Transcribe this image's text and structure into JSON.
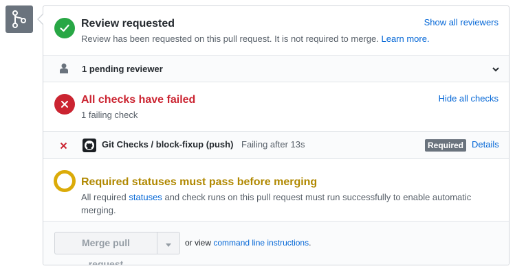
{
  "colors": {
    "success": "#28a745",
    "danger": "#cb2431",
    "warning": "#dbab09",
    "warning_text": "#b08800",
    "link": "#0366d6",
    "muted": "#586069",
    "badge": "#6a737d"
  },
  "side_icon": "git-merge-icon",
  "review": {
    "title": "Review requested",
    "description": "Review has been requested on this pull request. It is not required to merge.",
    "learn_more": "Learn more.",
    "action": "Show all reviewers",
    "icon": "check-icon"
  },
  "pending": {
    "label": "1 pending reviewer",
    "icon": "person-icon",
    "toggle_icon": "chevron-down-icon"
  },
  "checks": {
    "title": "All checks have failed",
    "subtitle": "1 failing check",
    "action": "Hide all checks",
    "icon": "x-icon",
    "items": [
      {
        "status_icon": "x-icon",
        "avatar_icon": "github-icon",
        "name": "Git Checks / block-fixup (push)",
        "description": "Failing after 13s",
        "badge": "Required",
        "link": "Details"
      }
    ]
  },
  "required_statuses": {
    "title": "Required statuses must pass before merging",
    "text_before": "All required",
    "statuses_link": "statuses",
    "text_after": "and check runs on this pull request must run successfully to enable automatic merging.",
    "icon": "pending-circle-icon"
  },
  "merge": {
    "button_label": "Merge pull request",
    "dropdown_icon": "triangle-down-icon",
    "alt_prefix": "or view",
    "alt_link": "command line instructions",
    "alt_suffix": "."
  }
}
